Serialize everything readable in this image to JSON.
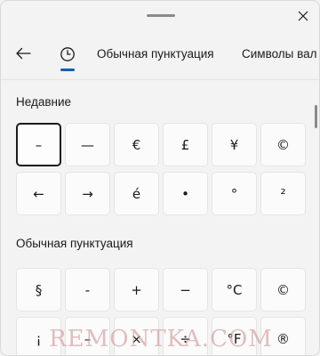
{
  "header": {
    "close_icon": "close-icon"
  },
  "nav": {
    "back_icon": "arrow-left-icon",
    "recent_icon": "clock-icon",
    "tabs": [
      {
        "label": "Обычная пунктуация"
      },
      {
        "label": "Символы вал"
      }
    ]
  },
  "recent": {
    "title": "Недавние",
    "keys": [
      "–",
      "—",
      "€",
      "£",
      "¥",
      "©",
      "←",
      "→",
      "é",
      "•",
      "°",
      "²"
    ]
  },
  "punct": {
    "title": "Обычная пунктуация",
    "keys": [
      "§",
      "-",
      "+",
      "−",
      "°C",
      "©",
      "¡",
      "–",
      "×",
      "÷",
      "°F",
      "®"
    ]
  },
  "watermark": "REMONTKA.COM",
  "colors": {
    "accent": "#005fb8",
    "background": "#f3f3f3",
    "key_background": "#fbfbfb"
  }
}
